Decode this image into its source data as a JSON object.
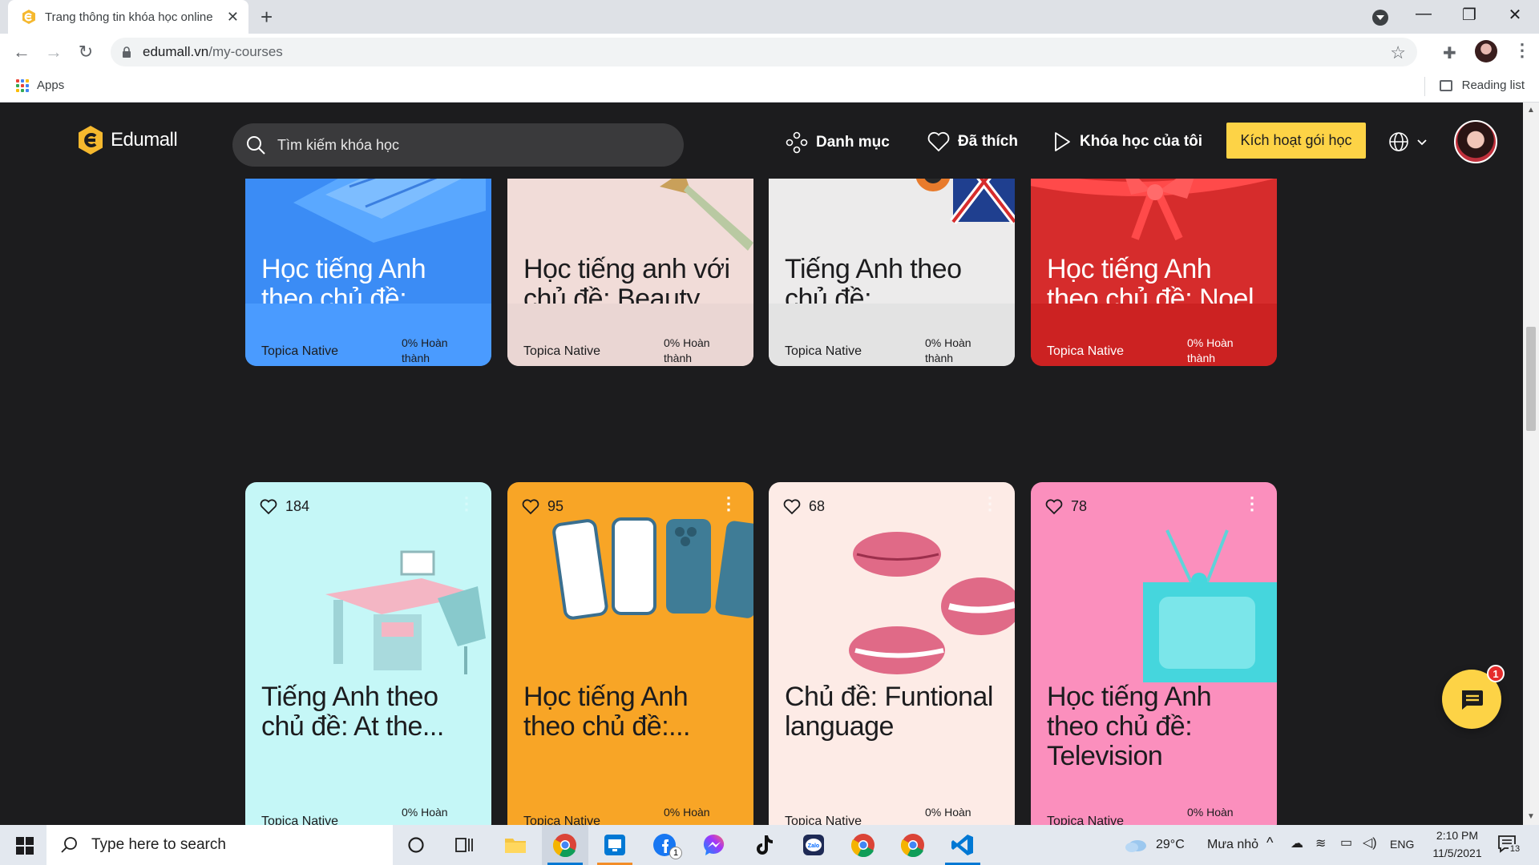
{
  "browser": {
    "tab_title": "Trang thông tin khóa học online",
    "url_domain": "edumall.vn",
    "url_path": "/my-courses",
    "bookmarks_apps": "Apps",
    "reading_list": "Reading list"
  },
  "header": {
    "logo_text": "Edumall",
    "search_placeholder": "Tìm kiếm khóa học",
    "nav_categories": "Danh mục",
    "nav_liked": "Đã thích",
    "nav_my_courses": "Khóa học của tôi",
    "activate_button": "Kích hoạt gói học"
  },
  "courses_row1": [
    {
      "title": "Học tiếng Anh theo chủ đề: Sleeping",
      "author": "Topica Native",
      "progress": "0% Hoàn thành",
      "bg": "#3b8cf5"
    },
    {
      "title": "Học tiếng anh với chủ đề: Beauty",
      "author": "Topica Native",
      "progress": "0% Hoàn thành",
      "bg": "#f1dcd8"
    },
    {
      "title": "Tiếng Anh theo chủ đề: Learning...",
      "author": "Topica Native",
      "progress": "0% Hoàn thành",
      "bg": "#ecebeb"
    },
    {
      "title": "Học tiếng Anh theo chủ đề: Noel",
      "author": "Topica Native",
      "progress": "0% Hoàn thành",
      "bg": "#d62c2c"
    }
  ],
  "courses_row2": [
    {
      "likes": "184",
      "title": "Tiếng Anh theo chủ đề: At the...",
      "author": "Topica Native",
      "progress": "0% Hoàn",
      "bg": "#c5f7f7"
    },
    {
      "likes": "95",
      "title": "Học tiếng Anh theo chủ đề:...",
      "author": "Topica Native",
      "progress": "0% Hoàn",
      "bg": "#f8a526"
    },
    {
      "likes": "68",
      "title": "Chủ đề: Funtional language",
      "author": "Topica Native",
      "progress": "0% Hoàn",
      "bg": "#fdebe6"
    },
    {
      "likes": "78",
      "title": "Học tiếng Anh theo chủ đề: Television",
      "author": "Topica Native",
      "progress": "0% Hoàn",
      "bg": "#fb8fbd"
    }
  ],
  "chat": {
    "badge": "1"
  },
  "taskbar": {
    "search_placeholder": "Type here to search",
    "weather_temp": "29°C",
    "weather_desc": "Mưa nhỏ",
    "lang": "ENG",
    "time": "2:10 PM",
    "date": "11/5/2021",
    "notifications": "13",
    "facebook_badge": "1"
  }
}
